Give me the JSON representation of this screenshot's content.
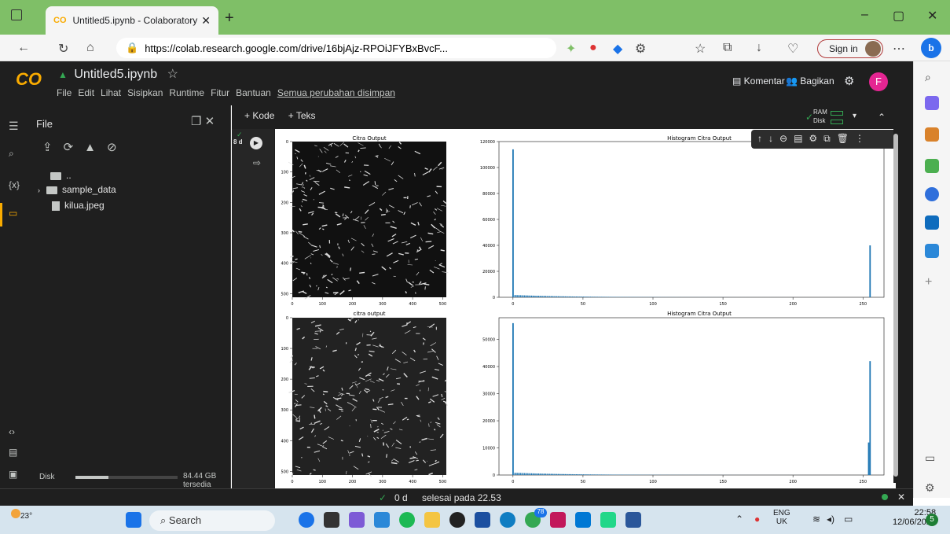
{
  "browser": {
    "tab_title": "Untitled5.ipynb - Colaboratory",
    "url": "https://colab.research.google.com/drive/16bjAjz-RPOiJFYBxBvcF...",
    "sign_in": "Sign in"
  },
  "colab": {
    "notebook_title": "Untitled5.ipynb",
    "menus": [
      "File",
      "Edit",
      "Lihat",
      "Sisipkan",
      "Runtime",
      "Fitur",
      "Bantuan"
    ],
    "saved_status": "Semua perubahan disimpan",
    "comment_label": "Komentar",
    "share_label": "Bagikan",
    "user_initial": "F",
    "add_code": "+ Kode",
    "add_text": "+ Teks",
    "ram_label": "RAM",
    "disk_label": "Disk"
  },
  "file_panel": {
    "title": "File",
    "parent_dir": "..",
    "items": [
      {
        "name": "sample_data",
        "type": "folder"
      },
      {
        "name": "kilua.jpeg",
        "type": "file"
      }
    ],
    "disk_label": "Disk",
    "disk_free": "84.44 GB tersedia"
  },
  "cell": {
    "exec_time": "8 d",
    "status_time": "0 d",
    "status_text": "selesai pada 22.53"
  },
  "chart_data": [
    {
      "type": "image",
      "title": "Citra Output",
      "xticks": [
        0,
        100,
        200,
        300,
        400,
        500
      ],
      "yticks": [
        0,
        100,
        200,
        300,
        400,
        500
      ]
    },
    {
      "type": "bar",
      "title": "Histogram Citra Output",
      "xticks": [
        0,
        50,
        100,
        150,
        200,
        250
      ],
      "yticks": [
        0,
        20000,
        40000,
        60000,
        80000,
        100000,
        120000
      ],
      "ylim": [
        0,
        120000
      ],
      "xlim": [
        -10,
        265
      ],
      "peaks": [
        {
          "x": 0,
          "y": 114000
        },
        {
          "x": 255,
          "y": 40000
        }
      ],
      "color": "#1f77b4"
    },
    {
      "type": "image",
      "title": "citra output",
      "xticks": [
        0,
        100,
        200,
        300,
        400,
        500
      ],
      "yticks": [
        0,
        100,
        200,
        300,
        400,
        500
      ]
    },
    {
      "type": "bar",
      "title": "Histogram Citra Output",
      "xticks": [
        0,
        50,
        100,
        150,
        200,
        250
      ],
      "yticks": [
        0,
        10000,
        20000,
        30000,
        40000,
        50000
      ],
      "ylim": [
        0,
        58000
      ],
      "xlim": [
        -10,
        265
      ],
      "peaks": [
        {
          "x": 0,
          "y": 56000
        },
        {
          "x": 254,
          "y": 12000
        },
        {
          "x": 255,
          "y": 42000
        }
      ],
      "color": "#1f77b4"
    }
  ],
  "taskbar": {
    "weather": "23°",
    "search": "Search",
    "lang": "ENG",
    "region": "UK",
    "time": "22:58",
    "date": "12/06/2023",
    "notif": "5",
    "badge": "78"
  }
}
